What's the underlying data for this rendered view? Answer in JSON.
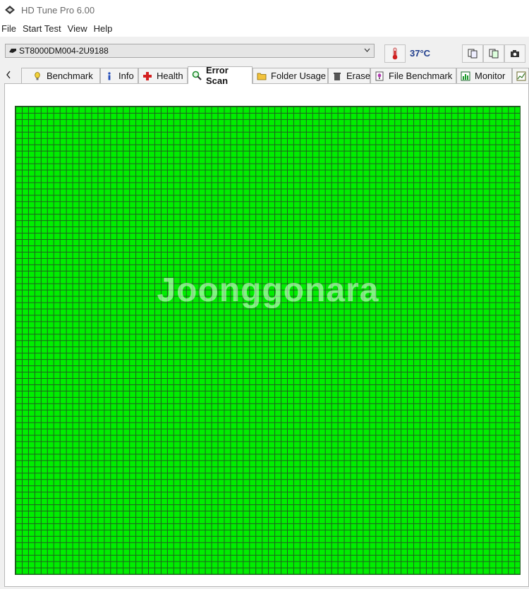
{
  "window": {
    "title": "HD Tune Pro 6.00"
  },
  "menu": {
    "items": [
      "File",
      "Start Test",
      "View",
      "Help"
    ]
  },
  "toolbar": {
    "drive": "ST8000DM004-2U9188",
    "temperature": "37°C"
  },
  "tabs": [
    {
      "label": "Benchmark",
      "icon": "lightbulb-icon"
    },
    {
      "label": "Info",
      "icon": "info-icon"
    },
    {
      "label": "Health",
      "icon": "health-cross-icon"
    },
    {
      "label": "Error Scan",
      "icon": "magnifier-icon",
      "active": true
    },
    {
      "label": "Folder Usage",
      "icon": "folder-icon"
    },
    {
      "label": "Erase",
      "icon": "trash-icon"
    },
    {
      "label": "File Benchmark",
      "icon": "file-benchmark-icon"
    },
    {
      "label": "Monitor",
      "icon": "monitor-icon"
    }
  ],
  "scan": {
    "block_color": "#00ee00",
    "status": "all blocks ok"
  },
  "watermark": "Joonggonara"
}
